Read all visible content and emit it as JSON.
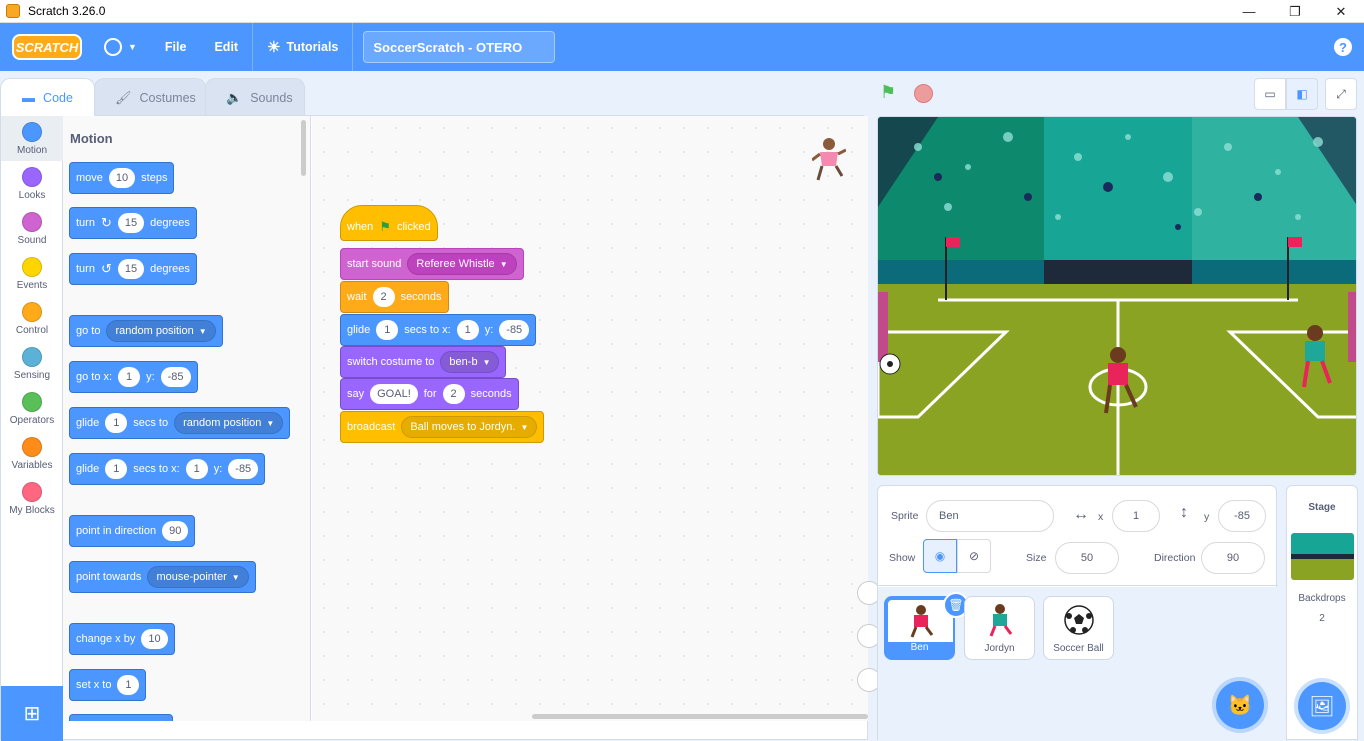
{
  "window": {
    "title": "Scratch 3.26.0",
    "minimize": "—",
    "restore": "❐",
    "close": "✕"
  },
  "menubar": {
    "logo": "SCRATCH",
    "language_icon": "globe-icon",
    "file": "File",
    "edit": "Edit",
    "tutorials": "Tutorials",
    "project_title": "SoccerScratch - OTERO",
    "help": "?"
  },
  "tabs": {
    "code": "Code",
    "costumes": "Costumes",
    "sounds": "Sounds"
  },
  "categories": [
    {
      "label": "Motion",
      "color": "#4c97ff"
    },
    {
      "label": "Looks",
      "color": "#9966ff"
    },
    {
      "label": "Sound",
      "color": "#cf63cf"
    },
    {
      "label": "Events",
      "color": "#ffd500"
    },
    {
      "label": "Control",
      "color": "#ffab19"
    },
    {
      "label": "Sensing",
      "color": "#5cb1d6"
    },
    {
      "label": "Operators",
      "color": "#59c059"
    },
    {
      "label": "Variables",
      "color": "#ff8c1a"
    },
    {
      "label": "My Blocks",
      "color": "#ff6680"
    }
  ],
  "palette": {
    "heading": "Motion",
    "move": {
      "a": "move",
      "v": "10",
      "b": "steps"
    },
    "turn_right": {
      "a": "turn",
      "v": "15",
      "b": "degrees"
    },
    "turn_left": {
      "a": "turn",
      "v": "15",
      "b": "degrees"
    },
    "goto": {
      "a": "go to",
      "dd": "random position"
    },
    "goto_xy": {
      "a": "go to x:",
      "x": "1",
      "b": "y:",
      "y": "-85"
    },
    "glide_to": {
      "a": "glide",
      "v": "1",
      "b": "secs to",
      "dd": "random position"
    },
    "glide_xy": {
      "a": "glide",
      "v": "1",
      "b": "secs to x:",
      "x": "1",
      "c": "y:",
      "y": "-85"
    },
    "point_dir": {
      "a": "point in direction",
      "v": "90"
    },
    "point_towards": {
      "a": "point towards",
      "dd": "mouse-pointer"
    },
    "change_x": {
      "a": "change x by",
      "v": "10"
    },
    "set_x": {
      "a": "set x to",
      "v": "1"
    }
  },
  "script": {
    "when_flag": {
      "a": "when",
      "b": "clicked"
    },
    "start_sound": {
      "a": "start sound",
      "dd": "Referee Whistle"
    },
    "wait": {
      "a": "wait",
      "v": "2",
      "b": "seconds"
    },
    "glide": {
      "a": "glide",
      "v": "1",
      "b": "secs to x:",
      "x": "1",
      "c": "y:",
      "y": "-85"
    },
    "switch_costume": {
      "a": "switch costume to",
      "dd": "ben-b"
    },
    "say": {
      "a": "say",
      "msg": "GOAL!",
      "b": "for",
      "v": "2",
      "c": "seconds"
    },
    "broadcast": {
      "a": "broadcast",
      "dd": "Ball moves to Jordyn."
    }
  },
  "sprite_info": {
    "sprite_label": "Sprite",
    "sprite_name": "Ben",
    "x_label": "x",
    "x_value": "1",
    "y_label": "y",
    "y_value": "-85",
    "show_label": "Show",
    "size_label": "Size",
    "size_value": "50",
    "direction_label": "Direction",
    "direction_value": "90"
  },
  "sprites": [
    {
      "name": "Ben",
      "selected": true
    },
    {
      "name": "Jordyn",
      "selected": false
    },
    {
      "name": "Soccer Ball",
      "selected": false
    }
  ],
  "stage_pane": {
    "title": "Stage",
    "backdrops_label": "Backdrops",
    "backdrops_count": "2"
  }
}
